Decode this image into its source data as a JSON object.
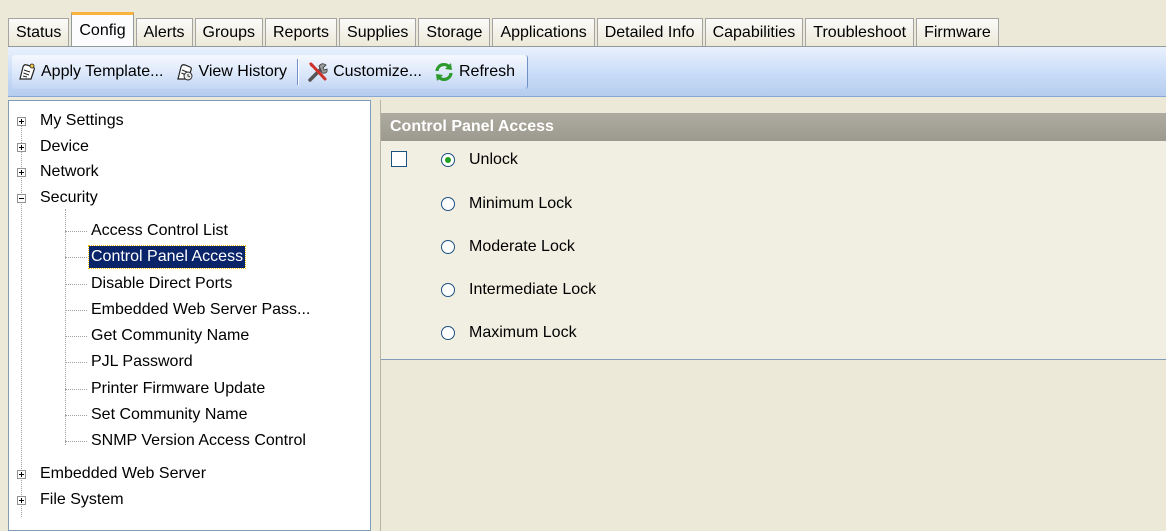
{
  "tabs": [
    {
      "label": "Status",
      "active": false
    },
    {
      "label": "Config",
      "active": true
    },
    {
      "label": "Alerts",
      "active": false
    },
    {
      "label": "Groups",
      "active": false
    },
    {
      "label": "Reports",
      "active": false
    },
    {
      "label": "Supplies",
      "active": false
    },
    {
      "label": "Storage",
      "active": false
    },
    {
      "label": "Applications",
      "active": false
    },
    {
      "label": "Detailed Info",
      "active": false
    },
    {
      "label": "Capabilities",
      "active": false
    },
    {
      "label": "Troubleshoot",
      "active": false
    },
    {
      "label": "Firmware",
      "active": false
    }
  ],
  "toolbar": {
    "apply_template": {
      "label": "Apply Template...",
      "icon": "template-icon"
    },
    "view_history": {
      "label": "View History",
      "icon": "history-icon"
    },
    "customize": {
      "label": "Customize...",
      "icon": "tools-icon"
    },
    "refresh": {
      "label": "Refresh",
      "icon": "refresh-icon"
    }
  },
  "tree": {
    "top_items": [
      {
        "label": "My Settings",
        "expanded": false
      },
      {
        "label": "Device",
        "expanded": false
      },
      {
        "label": "Network",
        "expanded": false
      },
      {
        "label": "Security",
        "expanded": true
      }
    ],
    "security_children": [
      {
        "label": "Access Control List",
        "selected": false
      },
      {
        "label": "Control Panel Access",
        "selected": true
      },
      {
        "label": "Disable Direct Ports",
        "selected": false
      },
      {
        "label": "Embedded Web Server Pass...",
        "selected": false
      },
      {
        "label": "Get Community Name",
        "selected": false
      },
      {
        "label": "PJL Password",
        "selected": false
      },
      {
        "label": "Printer Firmware Update",
        "selected": false
      },
      {
        "label": "Set Community Name",
        "selected": false
      },
      {
        "label": "SNMP Version Access Control",
        "selected": false
      }
    ],
    "bottom_items": [
      {
        "label": "Embedded Web Server",
        "expanded": false
      },
      {
        "label": "File System",
        "expanded": false
      }
    ]
  },
  "panel": {
    "title": "Control Panel Access",
    "enable_checked": false,
    "options": [
      {
        "label": "Unlock",
        "checked": true
      },
      {
        "label": "Minimum Lock",
        "checked": false
      },
      {
        "label": "Moderate Lock",
        "checked": false
      },
      {
        "label": "Intermediate Lock",
        "checked": false
      },
      {
        "label": "Maximum Lock",
        "checked": false
      }
    ]
  },
  "colors": {
    "selection": "#0a246a",
    "header": "#a3a094",
    "radio_dot": "#21a121",
    "toolbar": "#c9dcf7",
    "active_tab_accent": "#f8b33c"
  }
}
